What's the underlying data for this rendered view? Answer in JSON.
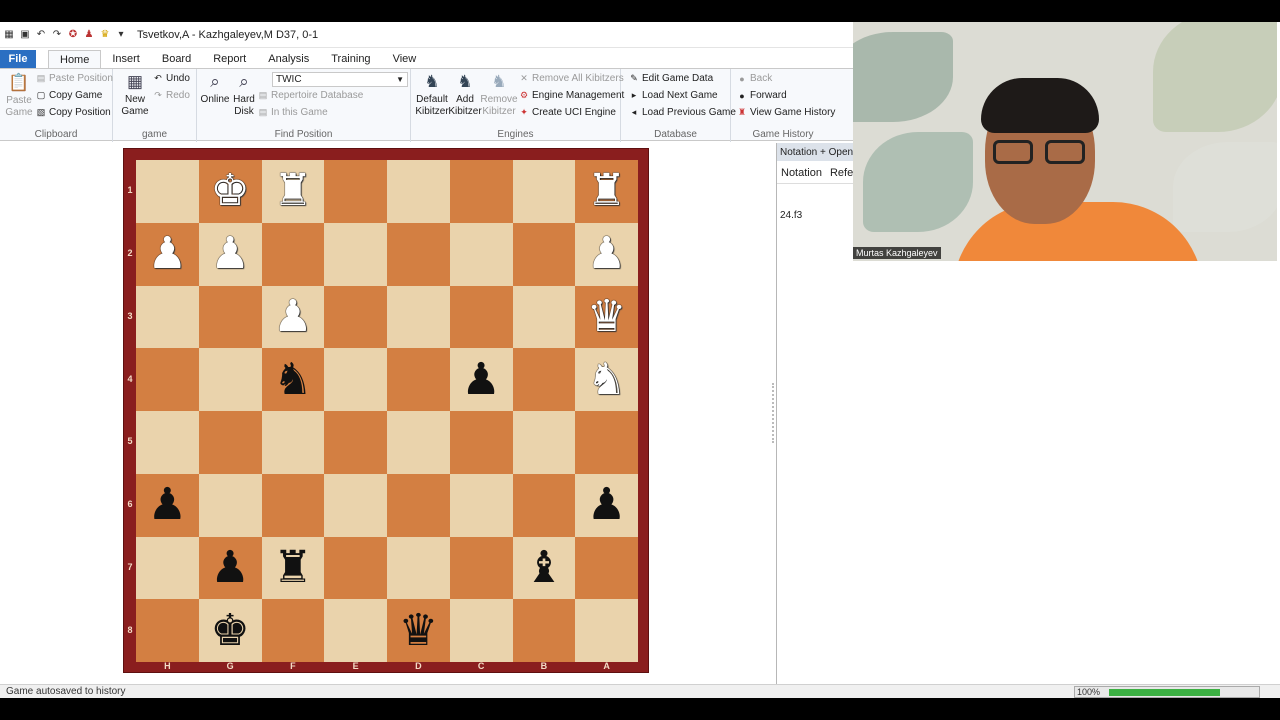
{
  "window": {
    "title": "Tsvetkov,A - Kazhgaleyev,M  D37, 0-1"
  },
  "menu": {
    "file": "File",
    "tabs": [
      "Home",
      "Insert",
      "Board",
      "Report",
      "Analysis",
      "Training",
      "View"
    ],
    "active": "Home"
  },
  "ribbon": {
    "clipboard": {
      "label": "Clipboard",
      "paste_game": "Paste\nGame",
      "paste_position": "Paste Position",
      "copy_game": "Copy Game",
      "copy_position": "Copy Position"
    },
    "game": {
      "label": "game",
      "new_game": "New\nGame",
      "undo": "Undo",
      "redo": "Redo"
    },
    "find_position": {
      "label": "Find Position",
      "online": "Online",
      "hard_disk": "Hard\nDisk",
      "database_value": "TWIC",
      "repertoire": "Repertoire Database",
      "in_this_game": "In this Game"
    },
    "engines": {
      "label": "Engines",
      "default_kibitzer": "Default\nKibitzer",
      "add_kibitzer": "Add\nKibitzer",
      "remove_kibitzer": "Remove\nKibitzer",
      "remove_all": "Remove All Kibitzers",
      "engine_management": "Engine Management",
      "create_uci": "Create UCI Engine"
    },
    "database": {
      "label": "Database",
      "edit_game_data": "Edit Game Data",
      "load_next": "Load Next Game",
      "load_previous": "Load Previous Game"
    },
    "game_history": {
      "label": "Game History",
      "back": "Back",
      "forward": "Forward",
      "view_history": "View Game History"
    }
  },
  "board": {
    "ranks": [
      "1",
      "2",
      "3",
      "4",
      "5",
      "6",
      "7",
      "8"
    ],
    "files": [
      "H",
      "G",
      "F",
      "E",
      "D",
      "C",
      "B",
      "A"
    ],
    "squares": [
      [
        "",
        "wK",
        "wR",
        "",
        "",
        "",
        "",
        "wR"
      ],
      [
        "wP",
        "wP",
        "",
        "",
        "",
        "",
        "",
        "wP"
      ],
      [
        "",
        "",
        "wP",
        "",
        "",
        "",
        "",
        "wQ"
      ],
      [
        "",
        "",
        "bN",
        "",
        "",
        "bP",
        "",
        "wN"
      ],
      [
        "",
        "",
        "",
        "",
        "",
        "",
        "",
        ""
      ],
      [
        "bP",
        "",
        "",
        "",
        "",
        "",
        "",
        "bP"
      ],
      [
        "",
        "bP",
        "bR",
        "",
        "",
        "",
        "bB",
        ""
      ],
      [
        "",
        "bK",
        "",
        "",
        "bQ",
        "",
        "",
        ""
      ]
    ]
  },
  "notation_panel": {
    "header": "Notation + Openin",
    "tabs": [
      "Notation",
      "Refer"
    ],
    "moves": "24.f3"
  },
  "webcam": {
    "name": "Murtas Kazhgaleyev"
  },
  "status": {
    "text": "Game autosaved to history",
    "zoom": "100%",
    "progress": 0.66
  },
  "colors": {
    "accent": "#2b6fc2",
    "board_light": "#ead3ac",
    "board_dark": "#d37f42",
    "board_frame": "#8a1e1e",
    "progress": "#3cb043"
  }
}
